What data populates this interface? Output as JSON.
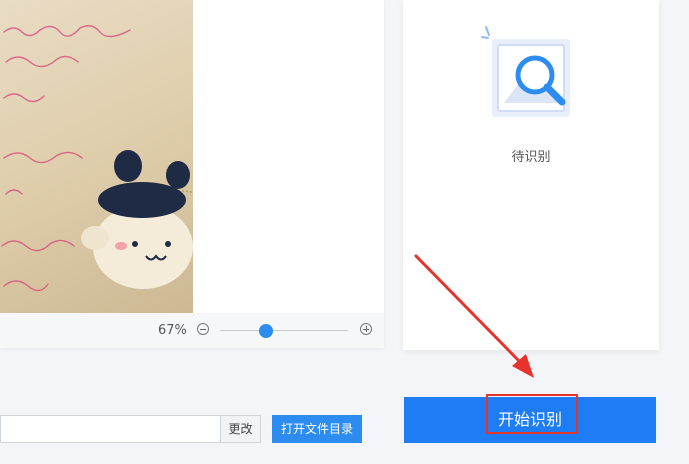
{
  "preview": {
    "image_alt": "photo-of-handwritten-note-with-toy",
    "zoom_value": "67%",
    "zoom_level": 0.36
  },
  "status": {
    "text": "待识别",
    "icon": "image-search-icon"
  },
  "output": {
    "path_value": "",
    "change_label": "更改",
    "open_dir_label": "打开文件目录"
  },
  "actions": {
    "start_label": "开始识别"
  },
  "colors": {
    "accent": "#2d8cf0",
    "primary_button": "#1e7cf5",
    "highlight": "#e8322c"
  }
}
